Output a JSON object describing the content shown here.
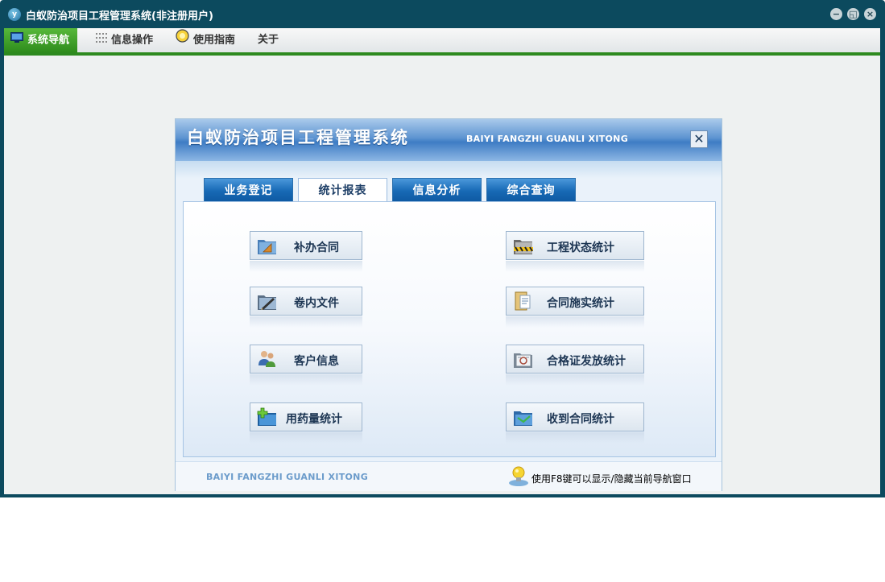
{
  "window": {
    "title": "白蚁防治项目工程管理系统(非注册用户)",
    "app_icon_glyph": "y"
  },
  "menubar": {
    "items": [
      {
        "label": "系统导航",
        "icon": "monitor-icon",
        "active": true
      },
      {
        "label": "信息操作",
        "icon": "grid-icon",
        "active": false
      },
      {
        "label": "使用指南",
        "icon": "bulb-circle-icon",
        "active": false
      },
      {
        "label": "关于",
        "icon": "",
        "active": false
      }
    ]
  },
  "panel": {
    "title": "白蚁防治项目工程管理系统",
    "subtitle": "BAIYI FANGZHI GUANLI XITONG",
    "close_glyph": "✕",
    "tabs": [
      {
        "label": "业务登记",
        "active": false
      },
      {
        "label": "统计报表",
        "active": true
      },
      {
        "label": "信息分析",
        "active": false
      },
      {
        "label": "综合查询",
        "active": false
      }
    ],
    "buttons_left": [
      {
        "label": "补办合同",
        "icon": "folder-triangle-icon"
      },
      {
        "label": "卷内文件",
        "icon": "folder-pen-icon"
      },
      {
        "label": "客户信息",
        "icon": "users-icon"
      },
      {
        "label": "用药量统计",
        "icon": "folder-add-icon"
      }
    ],
    "buttons_right": [
      {
        "label": "工程状态统计",
        "icon": "folder-tape-icon"
      },
      {
        "label": "合同施实统计",
        "icon": "document-folder-icon"
      },
      {
        "label": "合格证发放统计",
        "icon": "certificate-icon"
      },
      {
        "label": "收到合同统计",
        "icon": "folder-received-icon"
      }
    ],
    "footer": {
      "left_text": "BAIYI FANGZHI GUANLI XITONG",
      "hint": "使用F8键可以显示/隐藏当前导航窗口"
    }
  },
  "colors": {
    "window_frame": "#0c4a5e",
    "menu_active": "#3a9a26",
    "tab_blue": "#1769b5",
    "content_bg": "#eef1f1"
  }
}
